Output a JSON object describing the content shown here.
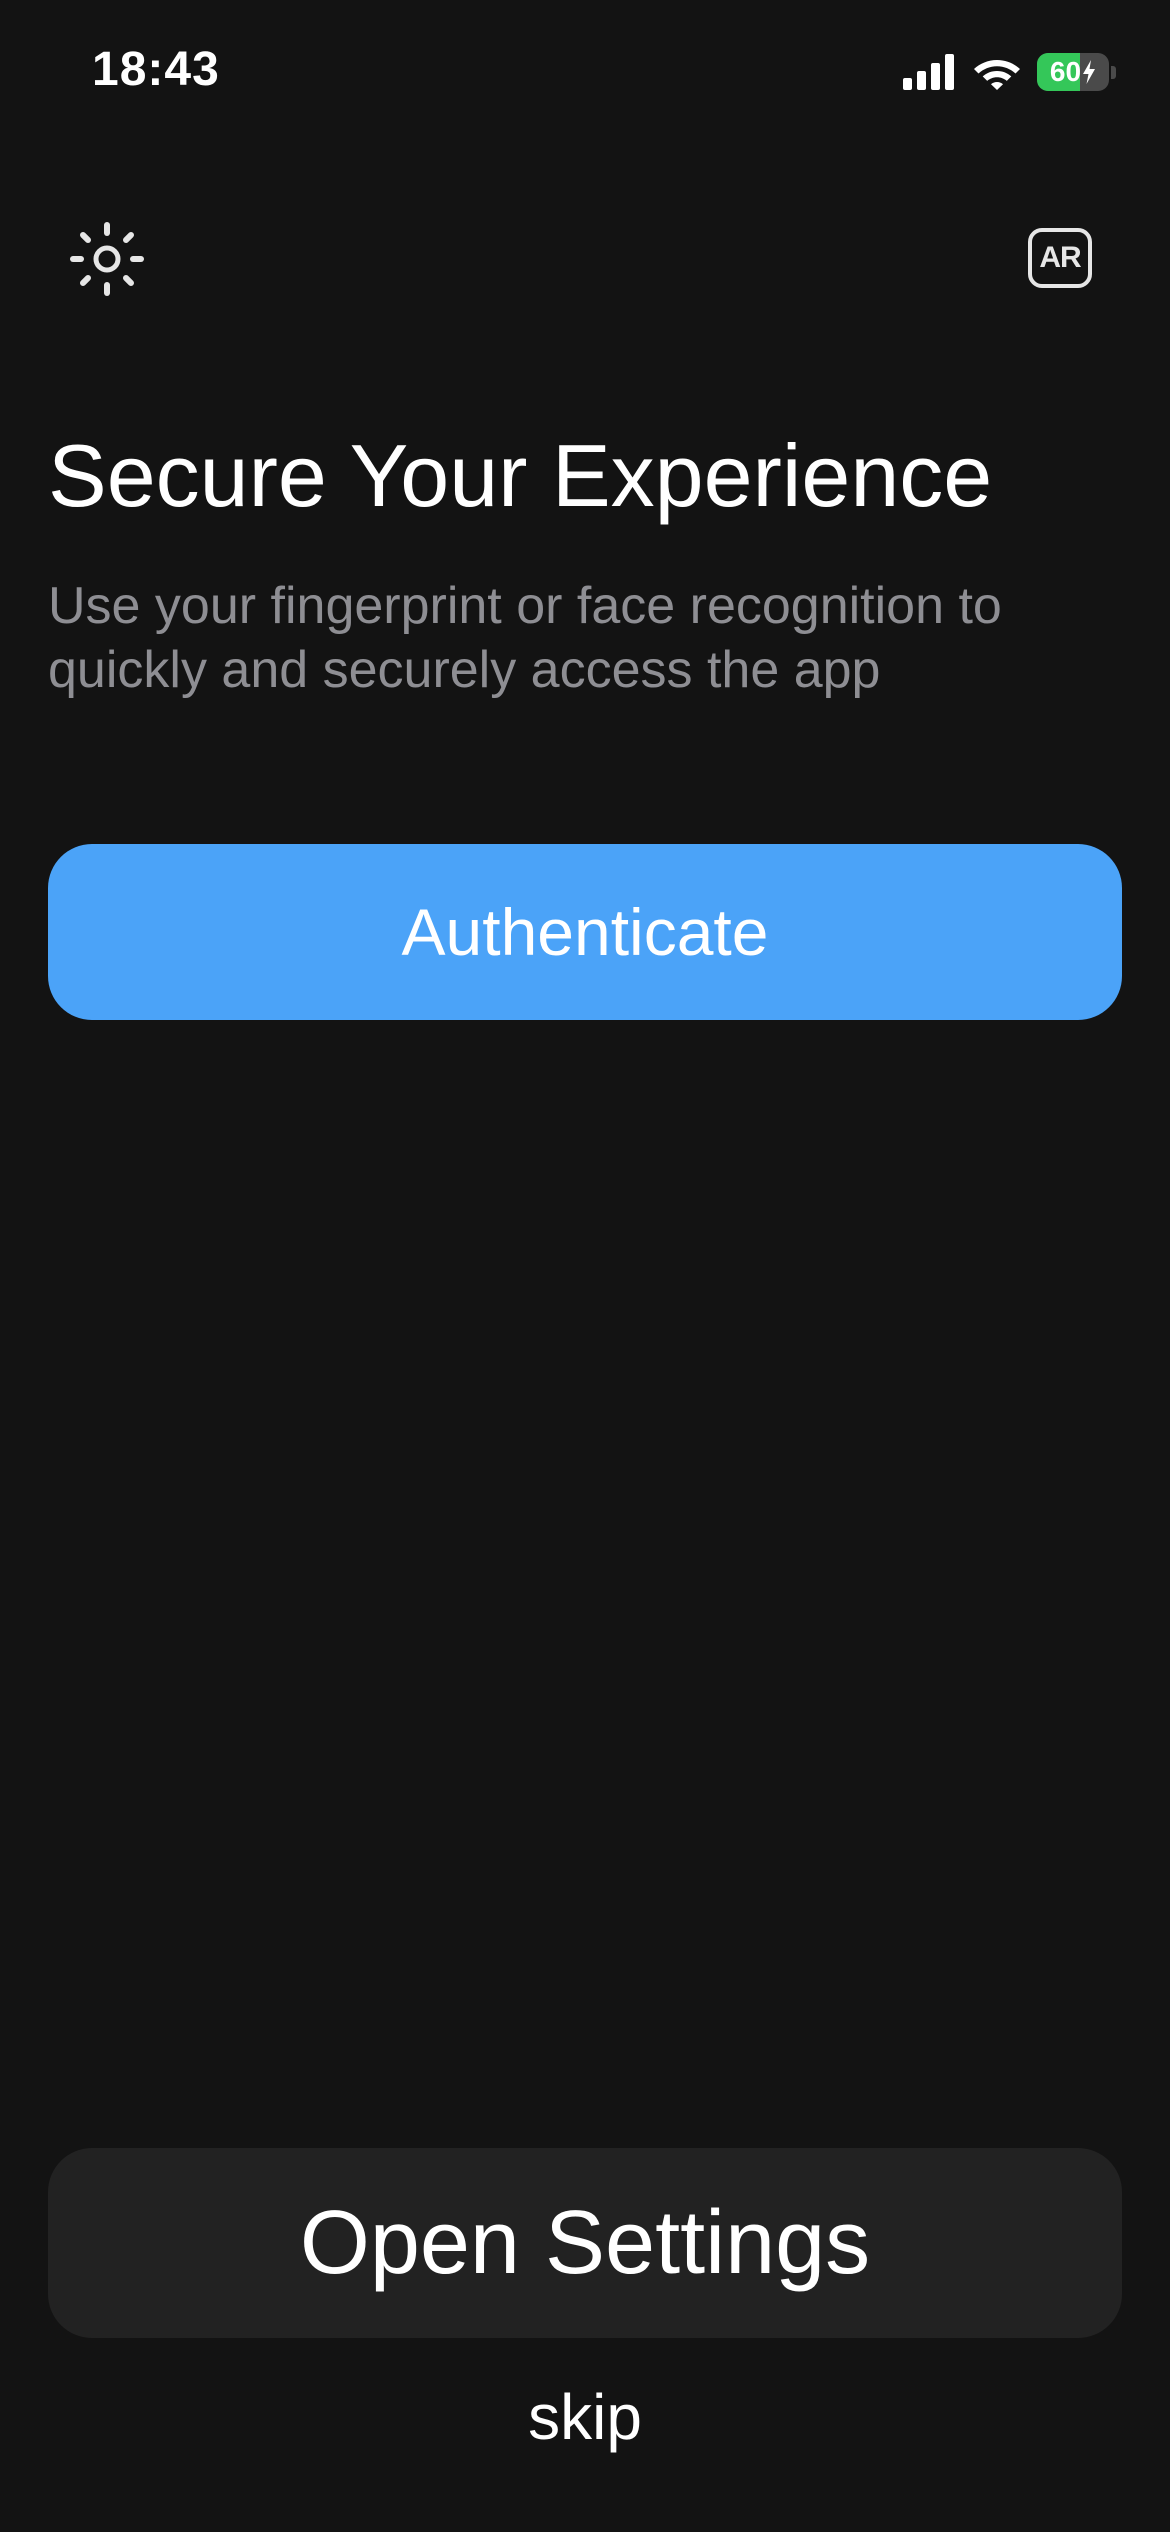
{
  "status_bar": {
    "time": "18:43",
    "battery_percent": 60,
    "battery_label": "60",
    "charging": true,
    "icons": [
      "signal-icon",
      "wifi-icon",
      "battery-icon",
      "charging-bolt-icon"
    ]
  },
  "toolbar": {
    "theme_icon": "sun-icon",
    "language_label": "AR"
  },
  "main": {
    "title": "Secure Your Experience",
    "subtitle": "Use your fingerprint or face recognition to quickly and securely access the app",
    "authenticate_label": "Authenticate"
  },
  "footer": {
    "open_settings_label": "Open Settings",
    "skip_label": "skip"
  },
  "colors": {
    "background": "#131313",
    "primary_button": "#4ba3f8",
    "secondary_button": "#222222",
    "subtitle_text": "#8e8e93",
    "battery_fill": "#34c759"
  }
}
